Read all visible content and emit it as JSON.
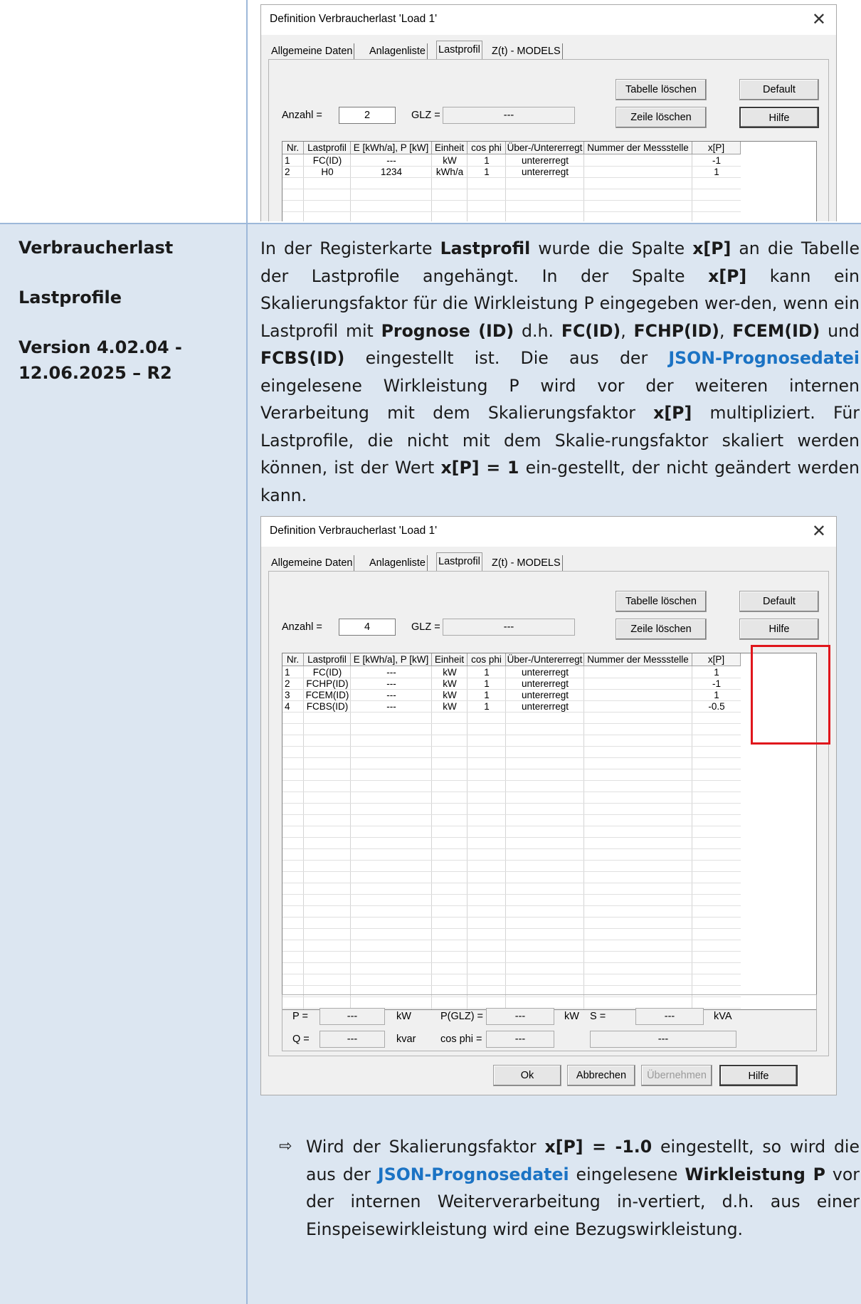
{
  "left": {
    "topic": "Verbraucherlast",
    "subtopic": "Lastprofile",
    "version": "Version 4.02.04 - 12.06.2025 – R2"
  },
  "paragraph": {
    "t1": "In der Registerkarte ",
    "b1": "Lastprofil",
    "t2": " wurde die Spalte ",
    "b2": "x[P]",
    "t3": " an die Tabelle der Lastprofile angehängt. In der Spalte ",
    "b3": "x[P]",
    "t4": " kann ein Skalierungsfaktor für die Wirkleistung P eingegeben wer-den, wenn ein Lastprofil mit ",
    "b4": "Prognose (ID)",
    "t5": " d.h. ",
    "b5": "FC(ID)",
    "t6": ", ",
    "b6": "FCHP(ID)",
    "t7": ", ",
    "b7": "FCEM(ID)",
    "t8": " und ",
    "b8": "FCBS(ID)",
    "t9": " eingestellt ist. Die aus der ",
    "link1": "JSON-Prognosedatei",
    "t10": " eingelesene Wirkleistung P wird vor der weiteren internen Verarbeitung mit dem Skalierungsfaktor ",
    "b9": "x[P]",
    "t11": " multipliziert. Für Lastprofile, die nicht mit dem Skalie-rungsfaktor skaliert werden können, ist der Wert ",
    "b10": "x[P] = 1",
    "t12": " ein-gestellt, der nicht geändert werden kann."
  },
  "bullet": {
    "arrow": "⇨",
    "t1": "Wird der Skalierungsfaktor ",
    "b1": "x[P] = -1.0",
    "t2": " eingestellt, so wird die aus der ",
    "link1": "JSON-Prognosedatei",
    "t3": " eingelesene ",
    "b2": "Wirkleistung P",
    "t4": " vor der internen Weiterverarbeitung in-vertiert, d.h. aus einer Einspeisewirkleistung wird eine Bezugswirkleistung."
  },
  "dialog_common": {
    "title": "Definition Verbraucherlast 'Load 1'",
    "close": "✕",
    "tabs": [
      "Allgemeine Daten",
      "Anlagenliste",
      "Lastprofil",
      "Z(t) - MODELS"
    ],
    "btn_tabelle_loeschen": "Tabelle löschen",
    "btn_default": "Default",
    "btn_zeile_loeschen": "Zeile löschen",
    "btn_hilfe": "Hilfe",
    "anzahl_label": "Anzahl =",
    "glz_label": "GLZ =",
    "glz_value": "---",
    "columns": [
      "Nr.",
      "Lastprofil",
      "E [kWh/a], P [kW]",
      "Einheit",
      "cos phi",
      "Über-/Untererregt",
      "Nummer der Messstelle",
      "x[P]"
    ]
  },
  "dialog1": {
    "anzahl": "2",
    "rows": [
      [
        "1",
        "FC(ID)",
        "---",
        "kW",
        "1",
        "untererregt",
        "",
        "-1"
      ],
      [
        "2",
        "H0",
        "1234",
        "kWh/a",
        "1",
        "untererregt",
        "",
        "1"
      ]
    ]
  },
  "dialog2": {
    "anzahl": "4",
    "rows": [
      [
        "1",
        "FC(ID)",
        "---",
        "kW",
        "1",
        "untererregt",
        "",
        "1"
      ],
      [
        "2",
        "FCHP(ID)",
        "---",
        "kW",
        "1",
        "untererregt",
        "",
        "-1"
      ],
      [
        "3",
        "FCEM(ID)",
        "---",
        "kW",
        "1",
        "untererregt",
        "",
        "1"
      ],
      [
        "4",
        "FCBS(ID)",
        "---",
        "kW",
        "1",
        "untererregt",
        "",
        "-0.5"
      ]
    ],
    "summary": {
      "p_label": "P =",
      "p_value": "---",
      "p_unit": "kW",
      "pglz_label": "P(GLZ) =",
      "pglz_value": "---",
      "pglz_unit": "kW",
      "s_label": "S =",
      "s_value": "---",
      "s_unit": "kVA",
      "q_label": "Q =",
      "q_value": "---",
      "q_unit": "kvar",
      "cosphi_label": "cos phi =",
      "cosphi_value": "---",
      "extra_value": "---"
    },
    "footer": {
      "ok": "Ok",
      "abbrechen": "Abbrechen",
      "uebernehmen": "Übernehmen",
      "hilfe": "Hilfe"
    }
  },
  "colors": {
    "background_main": "#dce6f1",
    "link": "#1b73c4",
    "highlight": "#e0161c"
  }
}
